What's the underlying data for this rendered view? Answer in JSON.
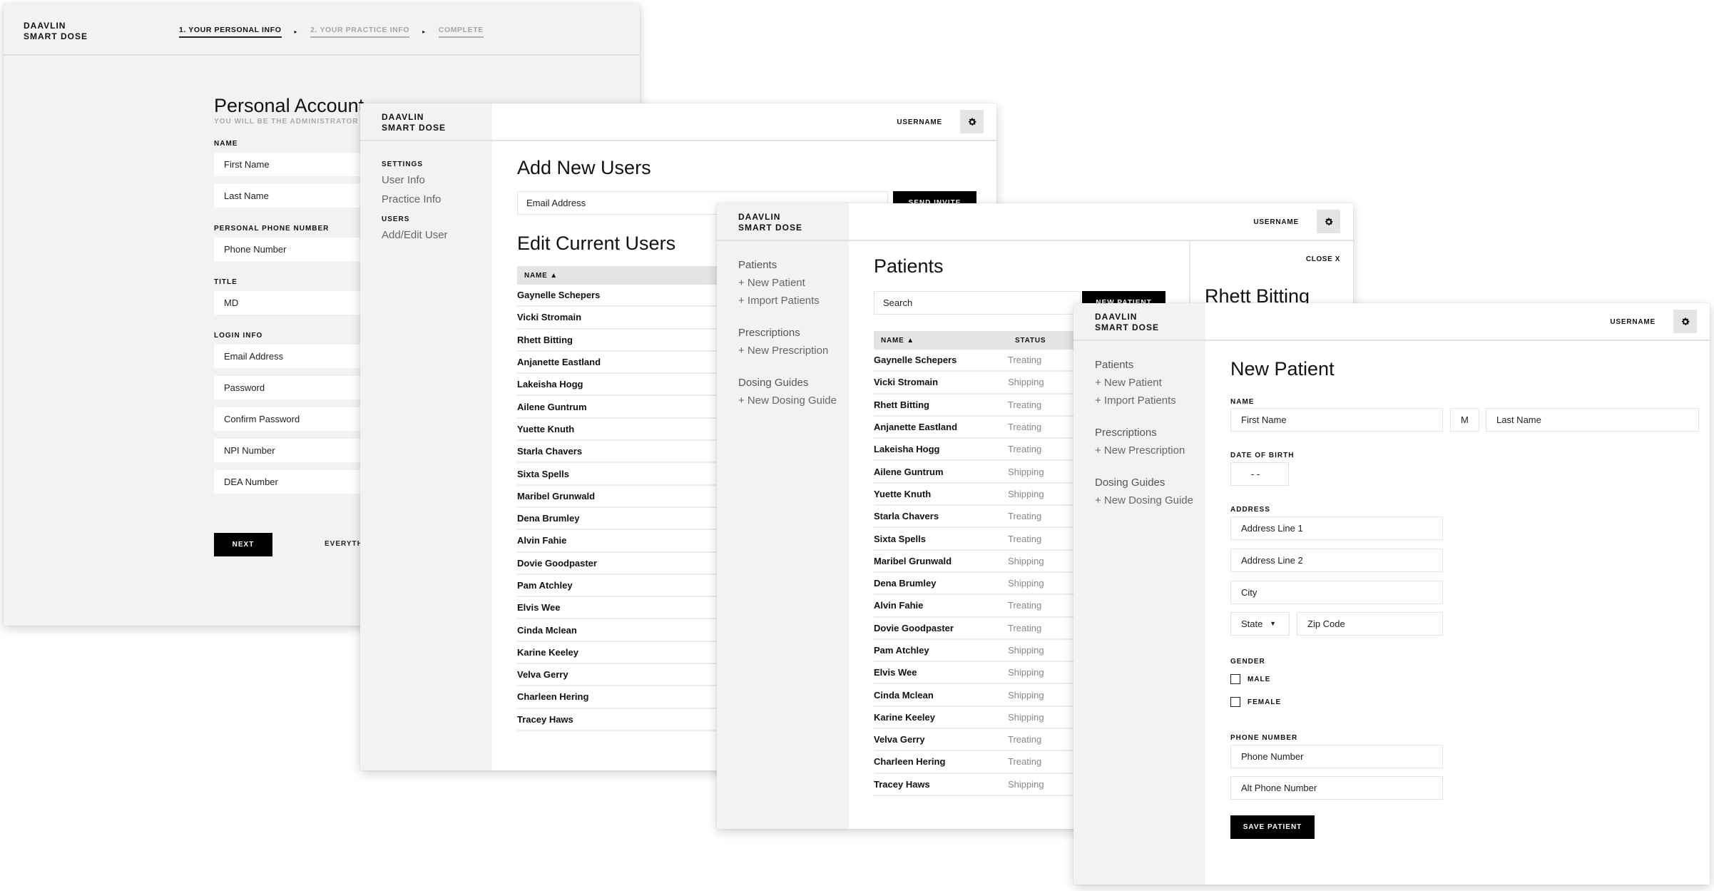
{
  "brand": {
    "line1": "DAAVLIN",
    "line2": "SMART DOSE"
  },
  "username": "USERNAME",
  "onboarding": {
    "steps": [
      {
        "label": "1. YOUR PERSONAL INFO",
        "active": true
      },
      {
        "label": "2. YOUR PRACTICE INFO",
        "active": false
      },
      {
        "label": "COMPLETE",
        "active": false
      }
    ],
    "step_separator": "▸",
    "title": "Personal Account",
    "subtitle": "YOU WILL BE THE ADMINISTRATOR OF Y",
    "sections": [
      {
        "label": "NAME",
        "fields": [
          "First Name",
          "Last Name"
        ]
      },
      {
        "label": "PERSONAL PHONE NUMBER",
        "fields": [
          "Phone Number"
        ]
      },
      {
        "label": "TITLE",
        "fields": [
          "MD"
        ]
      },
      {
        "label": "LOGIN INFO",
        "fields": [
          "Email Address",
          "Password",
          "Confirm Password",
          "NPI Number",
          "DEA Number"
        ]
      }
    ],
    "next_label": "NEXT",
    "everything_label": "EVERYTHI"
  },
  "settings": {
    "nav": [
      {
        "heading": "SETTINGS",
        "items": [
          "User Info",
          "Practice Info"
        ]
      },
      {
        "heading": "USERS",
        "items": [
          "Add/Edit User"
        ]
      }
    ],
    "add_title": "Add New Users",
    "email_placeholder": "Email Address",
    "send_invite_label": "SEND INVITE",
    "edit_title": "Edit Current Users",
    "table_header": "NAME ▲",
    "users": [
      "Gaynelle Schepers",
      "Vicki Stromain",
      "Rhett Bitting",
      "Anjanette Eastland",
      "Lakeisha Hogg",
      "Ailene Guntrum",
      "Yuette Knuth",
      "Starla Chavers",
      "Sixta Spells",
      "Maribel Grunwald",
      "Dena Brumley",
      "Alvin Fahie",
      "Dovie Goodpaster",
      "Pam Atchley",
      "Elvis Wee",
      "Cinda Mclean",
      "Karine Keeley",
      "Velva Gerry",
      "Charleen Hering",
      "Tracey Haws"
    ]
  },
  "app_nav": [
    {
      "section": "Patients",
      "links": [
        "+ New Patient",
        "+ Import Patients"
      ]
    },
    {
      "section": "Prescriptions",
      "links": [
        "+ New Prescription"
      ]
    },
    {
      "section": "Dosing Guides",
      "links": [
        "+ New Dosing Guide"
      ]
    }
  ],
  "patients": {
    "title": "Patients",
    "search_placeholder": "Search",
    "new_patient_label": "NEW PATIENT",
    "columns": [
      "NAME ▲",
      "STATUS"
    ],
    "rows": [
      {
        "name": "Gaynelle Schepers",
        "status": "Treating"
      },
      {
        "name": "Vicki Stromain",
        "status": "Shipping"
      },
      {
        "name": "Rhett Bitting",
        "status": "Treating"
      },
      {
        "name": "Anjanette Eastland",
        "status": "Treating"
      },
      {
        "name": "Lakeisha Hogg",
        "status": "Treating"
      },
      {
        "name": "Ailene Guntrum",
        "status": "Shipping"
      },
      {
        "name": "Yuette Knuth",
        "status": "Shipping"
      },
      {
        "name": "Starla Chavers",
        "status": "Treating"
      },
      {
        "name": "Sixta Spells",
        "status": "Treating"
      },
      {
        "name": "Maribel Grunwald",
        "status": "Shipping"
      },
      {
        "name": "Dena Brumley",
        "status": "Shipping"
      },
      {
        "name": "Alvin Fahie",
        "status": "Treating"
      },
      {
        "name": "Dovie Goodpaster",
        "status": "Treating"
      },
      {
        "name": "Pam Atchley",
        "status": "Shipping"
      },
      {
        "name": "Elvis Wee",
        "status": "Shipping"
      },
      {
        "name": "Cinda Mclean",
        "status": "Shipping"
      },
      {
        "name": "Karine Keeley",
        "status": "Shipping"
      },
      {
        "name": "Velva Gerry",
        "status": "Treating"
      },
      {
        "name": "Charleen Hering",
        "status": "Treating"
      },
      {
        "name": "Tracey Haws",
        "status": "Shipping"
      }
    ],
    "detail": {
      "close_label": "CLOSE X",
      "name": "Rhett Bitting"
    }
  },
  "new_patient": {
    "title": "New Patient",
    "name_label": "NAME",
    "first_name": "First Name",
    "middle_initial": "M",
    "last_name": "Last Name",
    "dob_label": "DATE OF BIRTH",
    "dob_value": "-   -",
    "address_label": "ADDRESS",
    "address1": "Address Line 1",
    "address2": "Address Line 2",
    "city": "City",
    "state": "State",
    "state_caret": "▼",
    "zip": "Zip Code",
    "gender_label": "GENDER",
    "gender_options": [
      "MALE",
      "FEMALE"
    ],
    "phone_label": "PHONE NUMBER",
    "phone": "Phone Number",
    "alt_phone": "Alt Phone Number",
    "save_label": "SAVE PATIENT"
  }
}
